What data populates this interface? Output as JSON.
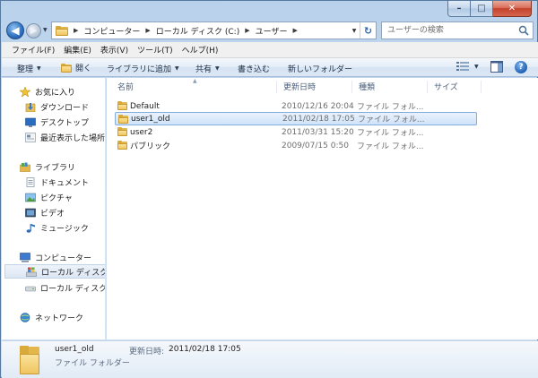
{
  "window": {
    "caption_buttons": {
      "minimize": "–",
      "maximize": "□",
      "close": "✕"
    }
  },
  "nav": {
    "back_glyph": "◀",
    "forward_glyph": "▶",
    "breadcrumbs": [
      "コンピューター",
      "ローカル ディスク (C:)",
      "ユーザー"
    ],
    "refresh_glyph": "↻"
  },
  "search": {
    "placeholder": "ユーザーの検索"
  },
  "menu": {
    "items": [
      "ファイル(F)",
      "編集(E)",
      "表示(V)",
      "ツール(T)",
      "ヘルプ(H)"
    ]
  },
  "commands": {
    "organize": "整理",
    "open": "開く",
    "include_in_library": "ライブラリに追加",
    "share": "共有",
    "burn": "書き込む",
    "new_folder": "新しいフォルダー",
    "help": "?"
  },
  "sidebar": {
    "favorites": {
      "label": "お気に入り",
      "items": [
        "ダウンロード",
        "デスクトップ",
        "最近表示した場所"
      ]
    },
    "libraries": {
      "label": "ライブラリ",
      "items": [
        "ドキュメント",
        "ピクチャ",
        "ビデオ",
        "ミュージック"
      ]
    },
    "computer": {
      "label": "コンピューター",
      "items": [
        "ローカル ディスク (",
        "ローカル ディスク ("
      ]
    },
    "network": {
      "label": "ネットワーク"
    }
  },
  "columns": {
    "name": "名前",
    "modified": "更新日時",
    "type": "種類",
    "size": "サイズ"
  },
  "files": [
    {
      "name": "Default",
      "modified": "2010/12/16 20:04",
      "type": "ファイル フォル..."
    },
    {
      "name": "user1_old",
      "modified": "2011/02/18 17:05",
      "type": "ファイル フォル..."
    },
    {
      "name": "user2",
      "modified": "2011/03/31 15:20",
      "type": "ファイル フォル..."
    },
    {
      "name": "パブリック",
      "modified": "2009/07/15 0:50",
      "type": "ファイル フォル..."
    }
  ],
  "details": {
    "name": "user1_old",
    "type": "ファイル フォルダー",
    "date_label": "更新日時:",
    "date_value": "2011/02/18 17:05"
  }
}
